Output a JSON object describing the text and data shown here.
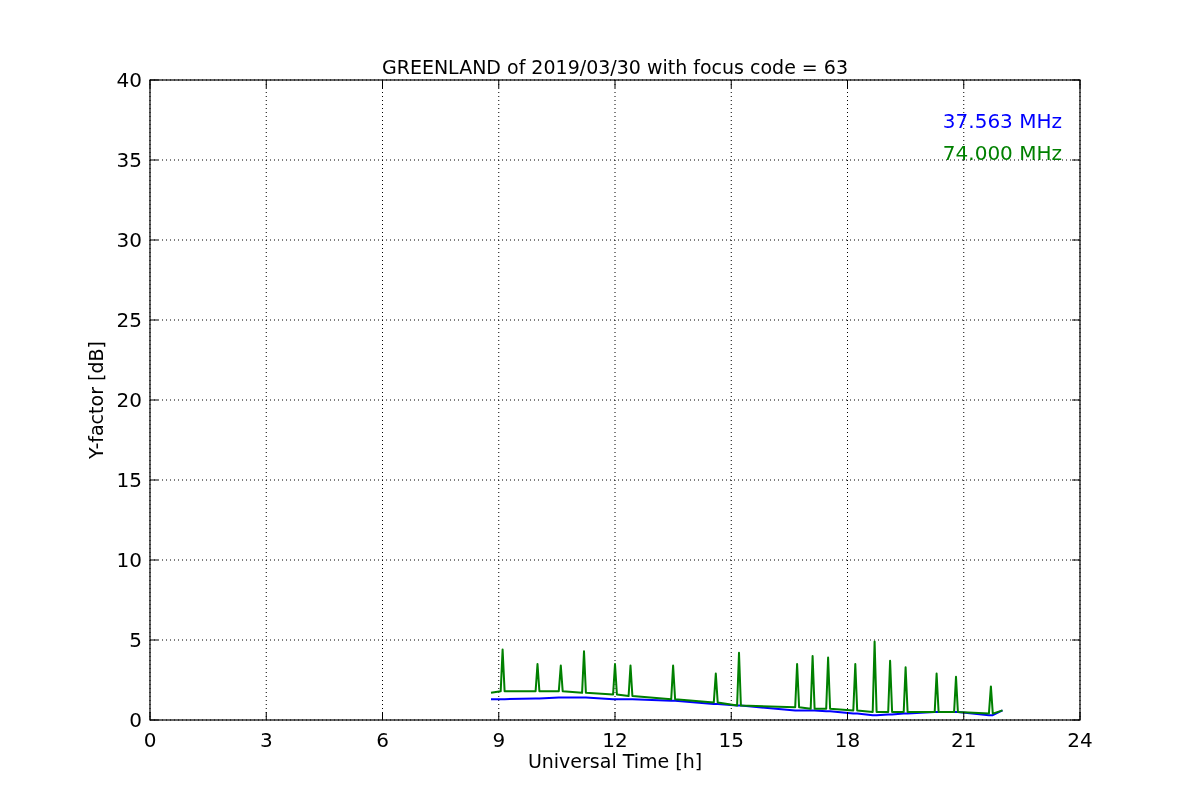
{
  "chart_data": {
    "type": "line",
    "title": "GREENLAND of 2019/03/30 with focus code = 63",
    "xlabel": "Universal Time [h]",
    "ylabel": "Y-factor [dB]",
    "grid": true,
    "xlim": [
      0,
      24
    ],
    "ylim": [
      0,
      40
    ],
    "xticks": [
      0,
      3,
      6,
      9,
      12,
      15,
      18,
      21,
      24
    ],
    "yticks": [
      0,
      5,
      10,
      15,
      20,
      25,
      30,
      35,
      40
    ],
    "x": [
      8.8,
      9.05,
      9.1,
      9.15,
      9.95,
      10.0,
      10.05,
      10.55,
      10.6,
      10.65,
      11.15,
      11.2,
      11.25,
      11.95,
      12.0,
      12.05,
      12.35,
      12.4,
      12.45,
      13.45,
      13.5,
      13.55,
      14.55,
      14.6,
      14.65,
      15.15,
      15.2,
      15.25,
      16.65,
      16.7,
      16.75,
      17.05,
      17.1,
      17.15,
      17.45,
      17.5,
      17.55,
      18.15,
      18.2,
      18.25,
      18.65,
      18.7,
      18.75,
      19.05,
      19.1,
      19.15,
      19.45,
      19.5,
      19.55,
      20.25,
      20.3,
      20.35,
      20.75,
      20.8,
      20.85,
      21.65,
      21.7,
      21.75,
      22.0
    ],
    "series": [
      {
        "name": "37.563 MHz",
        "color": "#0000ff",
        "values": [
          1.3,
          1.3,
          1.3,
          1.3,
          1.35,
          1.35,
          1.35,
          1.4,
          1.4,
          1.4,
          1.4,
          1.4,
          1.4,
          1.3,
          1.3,
          1.3,
          1.3,
          1.3,
          1.3,
          1.2,
          1.2,
          1.2,
          1.0,
          1.0,
          1.0,
          0.9,
          0.9,
          0.9,
          0.6,
          0.6,
          0.6,
          0.6,
          0.6,
          0.6,
          0.55,
          0.55,
          0.55,
          0.4,
          0.4,
          0.4,
          0.3,
          0.3,
          0.3,
          0.35,
          0.35,
          0.35,
          0.4,
          0.4,
          0.4,
          0.5,
          0.5,
          0.5,
          0.5,
          0.5,
          0.5,
          0.3,
          0.3,
          0.3,
          0.6
        ]
      },
      {
        "name": "74.000 MHz",
        "color": "#008000",
        "values": [
          1.7,
          1.8,
          4.4,
          1.8,
          1.8,
          3.5,
          1.8,
          1.8,
          3.4,
          1.8,
          1.7,
          4.3,
          1.7,
          1.6,
          3.5,
          1.6,
          1.5,
          3.4,
          1.5,
          1.3,
          3.4,
          1.3,
          1.1,
          2.9,
          1.1,
          0.9,
          4.2,
          0.9,
          0.8,
          3.5,
          0.8,
          0.7,
          4.0,
          0.7,
          0.7,
          3.9,
          0.7,
          0.6,
          3.5,
          0.6,
          0.5,
          4.9,
          0.5,
          0.5,
          3.7,
          0.5,
          0.5,
          3.3,
          0.5,
          0.5,
          2.9,
          0.5,
          0.5,
          2.7,
          0.5,
          0.4,
          2.1,
          0.4,
          0.6
        ]
      }
    ]
  }
}
